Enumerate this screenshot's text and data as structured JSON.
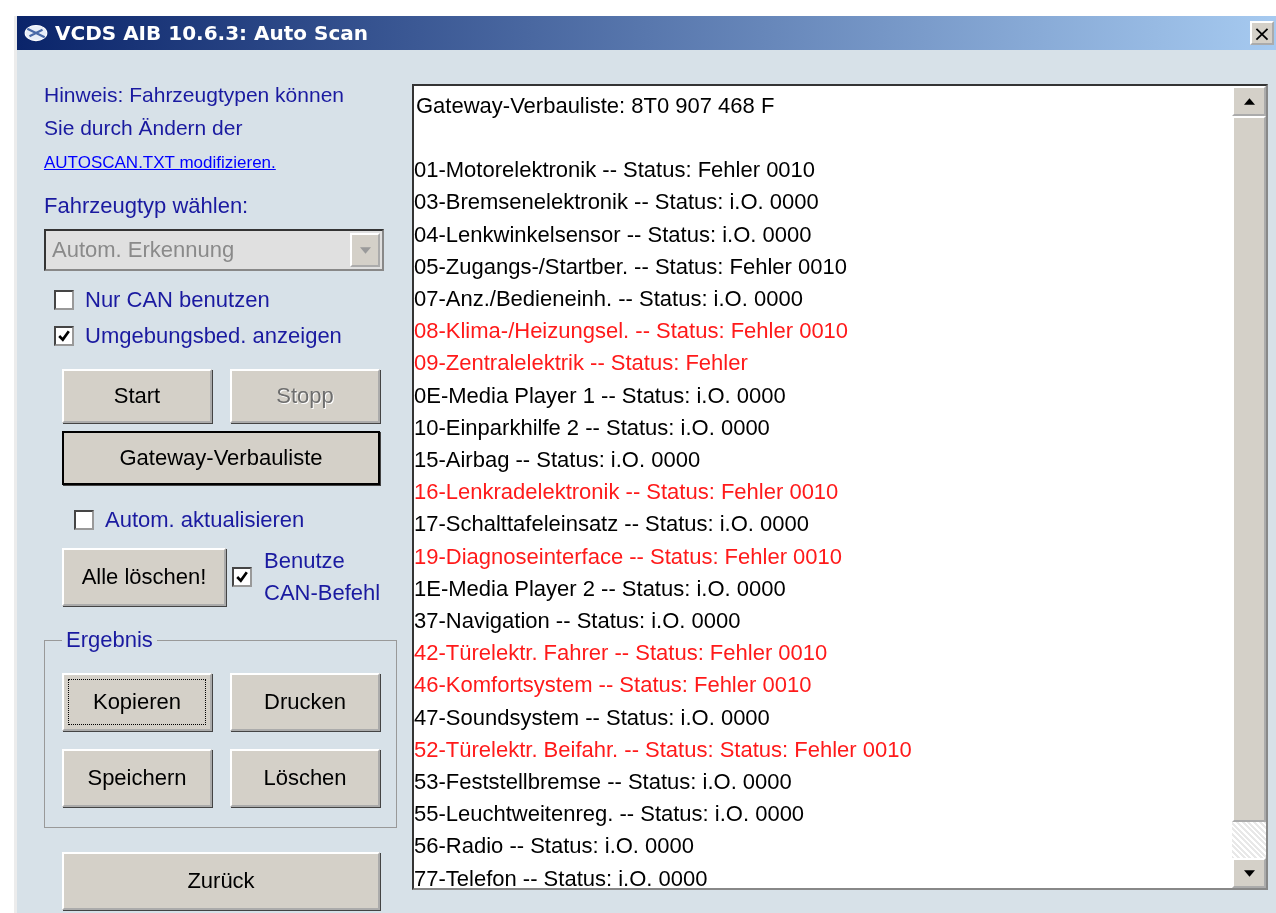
{
  "window": {
    "title": "VCDS AIB 10.6.3:  Auto Scan",
    "close": "×"
  },
  "hint": {
    "text": "Hinweis: Fahrzeugtypen können Sie durch Ändern der",
    "link": "AUTOSCAN.TXT modifizieren."
  },
  "vehicle_type": {
    "label": "Fahrzeugtyp wählen:",
    "value": "Autom. Erkennung",
    "disabled": true
  },
  "options": [
    {
      "label": "Nur CAN benutzen",
      "checked": false
    },
    {
      "label": "Umgebungsbed. anzeigen",
      "checked": true
    }
  ],
  "scan_buttons": [
    {
      "label": "Start",
      "disabled": false
    },
    {
      "label": "Stopp",
      "disabled": true
    }
  ],
  "gateway_button": {
    "label": "Gateway-Verbauliste"
  },
  "auto_update": {
    "label": "Autom. aktualisieren",
    "checked": false
  },
  "clear_all_button": {
    "label": "Alle löschen!"
  },
  "can_commands": {
    "label_lines": [
      "Benutze",
      "CAN-Befehl"
    ],
    "checked": true
  },
  "result_group": {
    "title": "Ergebnis",
    "buttons": [
      {
        "label": "Kopieren",
        "focused": true
      },
      {
        "label": "Drucken",
        "focused": false
      },
      {
        "label": "Speichern",
        "focused": false
      },
      {
        "label": "Löschen",
        "focused": false
      }
    ]
  },
  "back_button": {
    "label": "Zurück"
  },
  "results": [
    {
      "kind": "header",
      "text": "Gateway-Verbauliste:  8T0 907 468 F"
    },
    {
      "kind": "line",
      "text": "01-Motorelektronik -- Status: Fehler 0010",
      "error": false
    },
    {
      "kind": "line",
      "text": "03-Bremsenelektronik -- Status: i.O. 0000",
      "error": false
    },
    {
      "kind": "line",
      "text": "04-Lenkwinkelsensor -- Status: i.O. 0000",
      "error": false
    },
    {
      "kind": "line",
      "text": "05-Zugangs-/Startber. -- Status: Fehler 0010",
      "error": false
    },
    {
      "kind": "line",
      "text": "07-Anz./Bedieneinh. -- Status: i.O. 0000",
      "error": false
    },
    {
      "kind": "line",
      "text": "08-Klima-/Heizungsel. -- Status: Fehler 0010",
      "error": true
    },
    {
      "kind": "line",
      "text": "09-Zentralelektrik -- Status: Fehler",
      "error": true
    },
    {
      "kind": "line",
      "text": "0E-Media Player 1 -- Status: i.O. 0000",
      "error": false
    },
    {
      "kind": "line",
      "text": "10-Einparkhilfe 2 -- Status: i.O. 0000",
      "error": false
    },
    {
      "kind": "line",
      "text": "15-Airbag -- Status: i.O. 0000",
      "error": false
    },
    {
      "kind": "line",
      "text": "16-Lenkradelektronik -- Status: Fehler 0010",
      "error": true
    },
    {
      "kind": "line",
      "text": "17-Schalttafeleinsatz -- Status: i.O. 0000",
      "error": false
    },
    {
      "kind": "line",
      "text": "19-Diagnoseinterface -- Status: Fehler 0010",
      "error": true
    },
    {
      "kind": "line",
      "text": "1E-Media Player 2 -- Status: i.O. 0000",
      "error": false
    },
    {
      "kind": "line",
      "text": "37-Navigation -- Status: i.O. 0000",
      "error": false
    },
    {
      "kind": "line",
      "text": "42-Türelektr. Fahrer -- Status: Fehler 0010",
      "error": true
    },
    {
      "kind": "line",
      "text": "46-Komfortsystem -- Status: Fehler 0010",
      "error": true
    },
    {
      "kind": "line",
      "text": "47-Soundsystem -- Status: i.O. 0000",
      "error": false
    },
    {
      "kind": "line",
      "text": "52-Türelektr. Beifahr. -- Status: Status: Fehler 0010",
      "error": true
    },
    {
      "kind": "line",
      "text": "53-Feststellbremse -- Status: i.O. 0000",
      "error": false
    },
    {
      "kind": "line",
      "text": "55-Leuchtweitenreg. -- Status: i.O. 0000",
      "error": false
    },
    {
      "kind": "line",
      "text": "56-Radio -- Status: i.O. 0000",
      "error": false
    },
    {
      "kind": "line",
      "text": "77-Telefon -- Status: i.O. 0000",
      "error": false
    }
  ]
}
